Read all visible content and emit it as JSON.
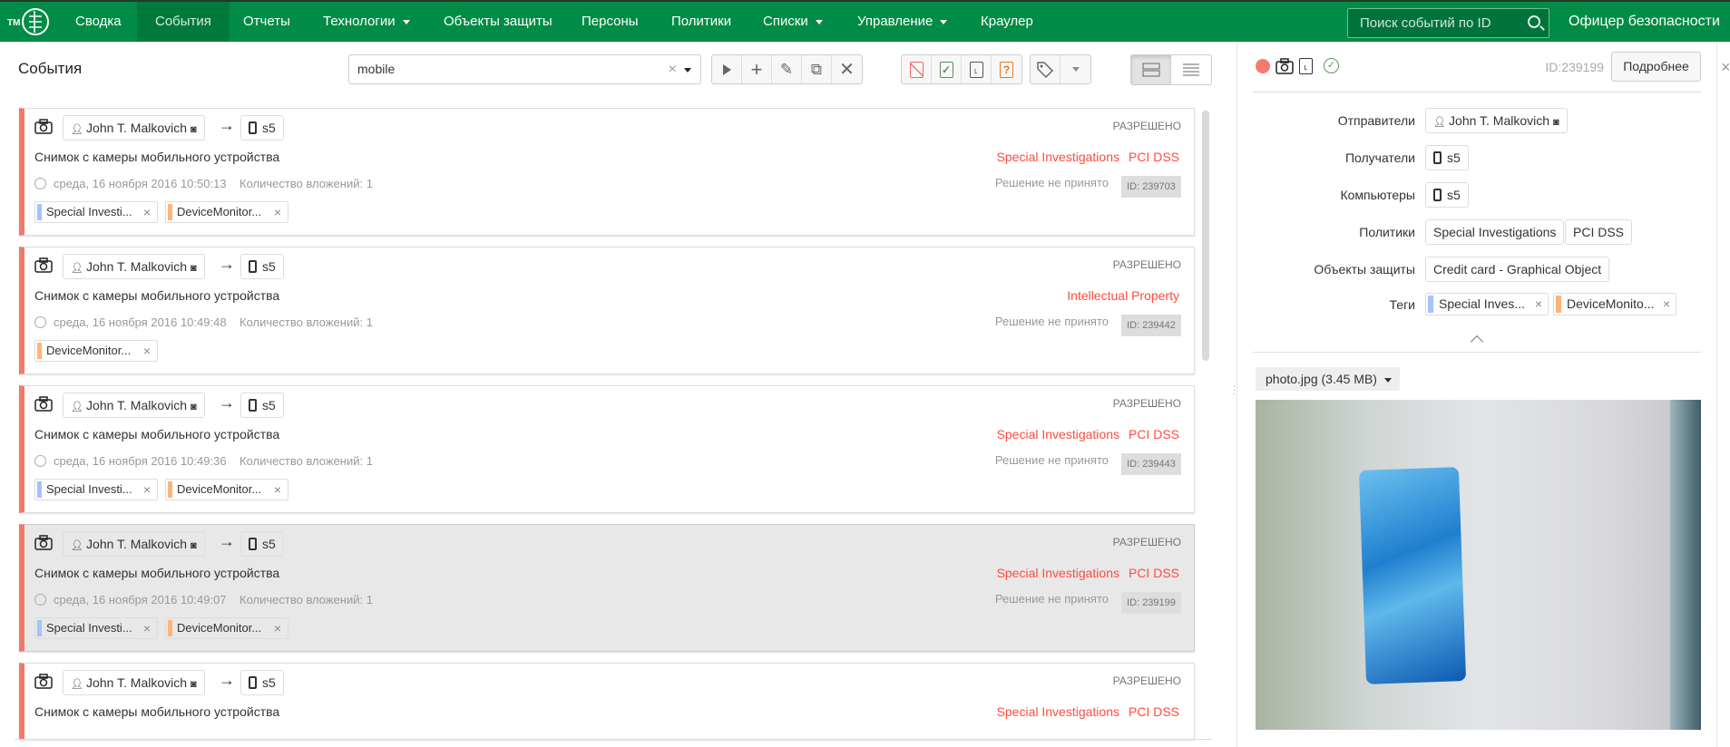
{
  "nav": {
    "logo_text": "TM",
    "items": [
      "Сводка",
      "События",
      "Отчеты",
      "Технологии",
      "Объекты защиты",
      "Персоны",
      "Политики",
      "Списки",
      "Управление",
      "Краулер"
    ],
    "active": "События",
    "search_placeholder": "Поиск событий по ID",
    "user": "Офицер безопасности"
  },
  "toolbar": {
    "title": "События",
    "filter_value": "mobile",
    "actions": [
      "play-icon",
      "plus-icon",
      "pencil-icon",
      "copy-icon",
      "close-icon"
    ],
    "status_filters": [
      "violation-icon",
      "approved-icon",
      "pending-icon",
      "unknown-icon"
    ],
    "status_unknown_glyph": "?",
    "view_modes": [
      "cards-view-icon",
      "list-view-icon"
    ],
    "active_view": "cards-view-icon"
  },
  "colors": {
    "brand": "#008c46",
    "violation": "#f07a6a",
    "policy": "#ff4b3e",
    "tag_blue": "#a8c0ff",
    "tag_orange": "#ffb37a"
  },
  "events": [
    {
      "sender": "John T. Malkovich",
      "arrow": "→",
      "recipient": "s5",
      "description": "Снимок с камеры мобильного устройства",
      "date": "среда, 16 ноября 2016 10:50:13",
      "attachments": "Количество вложений: 1",
      "status": "РАЗРЕШЕНО",
      "policies": [
        "Special Investigations",
        "PCI DSS"
      ],
      "decision": "Решение не принято",
      "id": "ID: 239703",
      "tags": [
        {
          "label": "Special Investi...",
          "color": "#a8c0ff"
        },
        {
          "label": "DeviceMonitor...",
          "color": "#ffb37a"
        }
      ]
    },
    {
      "sender": "John T. Malkovich",
      "arrow": "→",
      "recipient": "s5",
      "description": "Снимок с камеры мобильного устройства",
      "date": "среда, 16 ноября 2016 10:49:48",
      "attachments": "Количество вложений: 1",
      "status": "РАЗРЕШЕНО",
      "policies": [
        "Intellectual Property"
      ],
      "decision": "Решение не принято",
      "id": "ID: 239442",
      "tags": [
        {
          "label": "DeviceMonitor...",
          "color": "#ffb37a"
        }
      ]
    },
    {
      "sender": "John T. Malkovich",
      "arrow": "→",
      "recipient": "s5",
      "description": "Снимок с камеры мобильного устройства",
      "date": "среда, 16 ноября 2016 10:49:36",
      "attachments": "Количество вложений: 1",
      "status": "РАЗРЕШЕНО",
      "policies": [
        "Special Investigations",
        "PCI DSS"
      ],
      "decision": "Решение не принято",
      "id": "ID: 239443",
      "tags": [
        {
          "label": "Special Investi...",
          "color": "#a8c0ff"
        },
        {
          "label": "DeviceMonitor...",
          "color": "#ffb37a"
        }
      ]
    },
    {
      "sender": "John T. Malkovich",
      "arrow": "→",
      "recipient": "s5",
      "description": "Снимок с камеры мобильного устройства",
      "date": "среда, 16 ноября 2016 10:49:07",
      "attachments": "Количество вложений: 1",
      "status": "РАЗРЕШЕНО",
      "policies": [
        "Special Investigations",
        "PCI DSS"
      ],
      "decision": "Решение не принято",
      "id": "ID: 239199",
      "selected": true,
      "tags": [
        {
          "label": "Special Investi...",
          "color": "#a8c0ff"
        },
        {
          "label": "DeviceMonitor...",
          "color": "#ffb37a"
        }
      ]
    },
    {
      "sender": "John T. Malkovich",
      "arrow": "→",
      "recipient": "s5",
      "description": "Снимок с камеры мобильного устройства",
      "status": "РАЗРЕШЕНО",
      "policies": [
        "Special Investigations",
        "PCI DSS"
      ]
    }
  ],
  "detail": {
    "id": "ID:239199",
    "more_button": "Подробнее",
    "fields": {
      "senders_label": "Отправители",
      "senders": "John T. Malkovich",
      "recipients_label": "Получатели",
      "recipients": "s5",
      "computers_label": "Компьютеры",
      "computers": "s5",
      "policies_label": "Политики",
      "policies": [
        "Special Investigations",
        "PCI DSS"
      ],
      "objects_label": "Объекты защиты",
      "objects": "Credit card - Graphical Object",
      "tags_label": "Теги",
      "tags": [
        {
          "label": "Special Inves...",
          "color": "#a8c0ff"
        },
        {
          "label": "DeviceMonito...",
          "color": "#ffb37a"
        }
      ]
    },
    "attachment": "photo.jpg (3.45 MB)"
  }
}
